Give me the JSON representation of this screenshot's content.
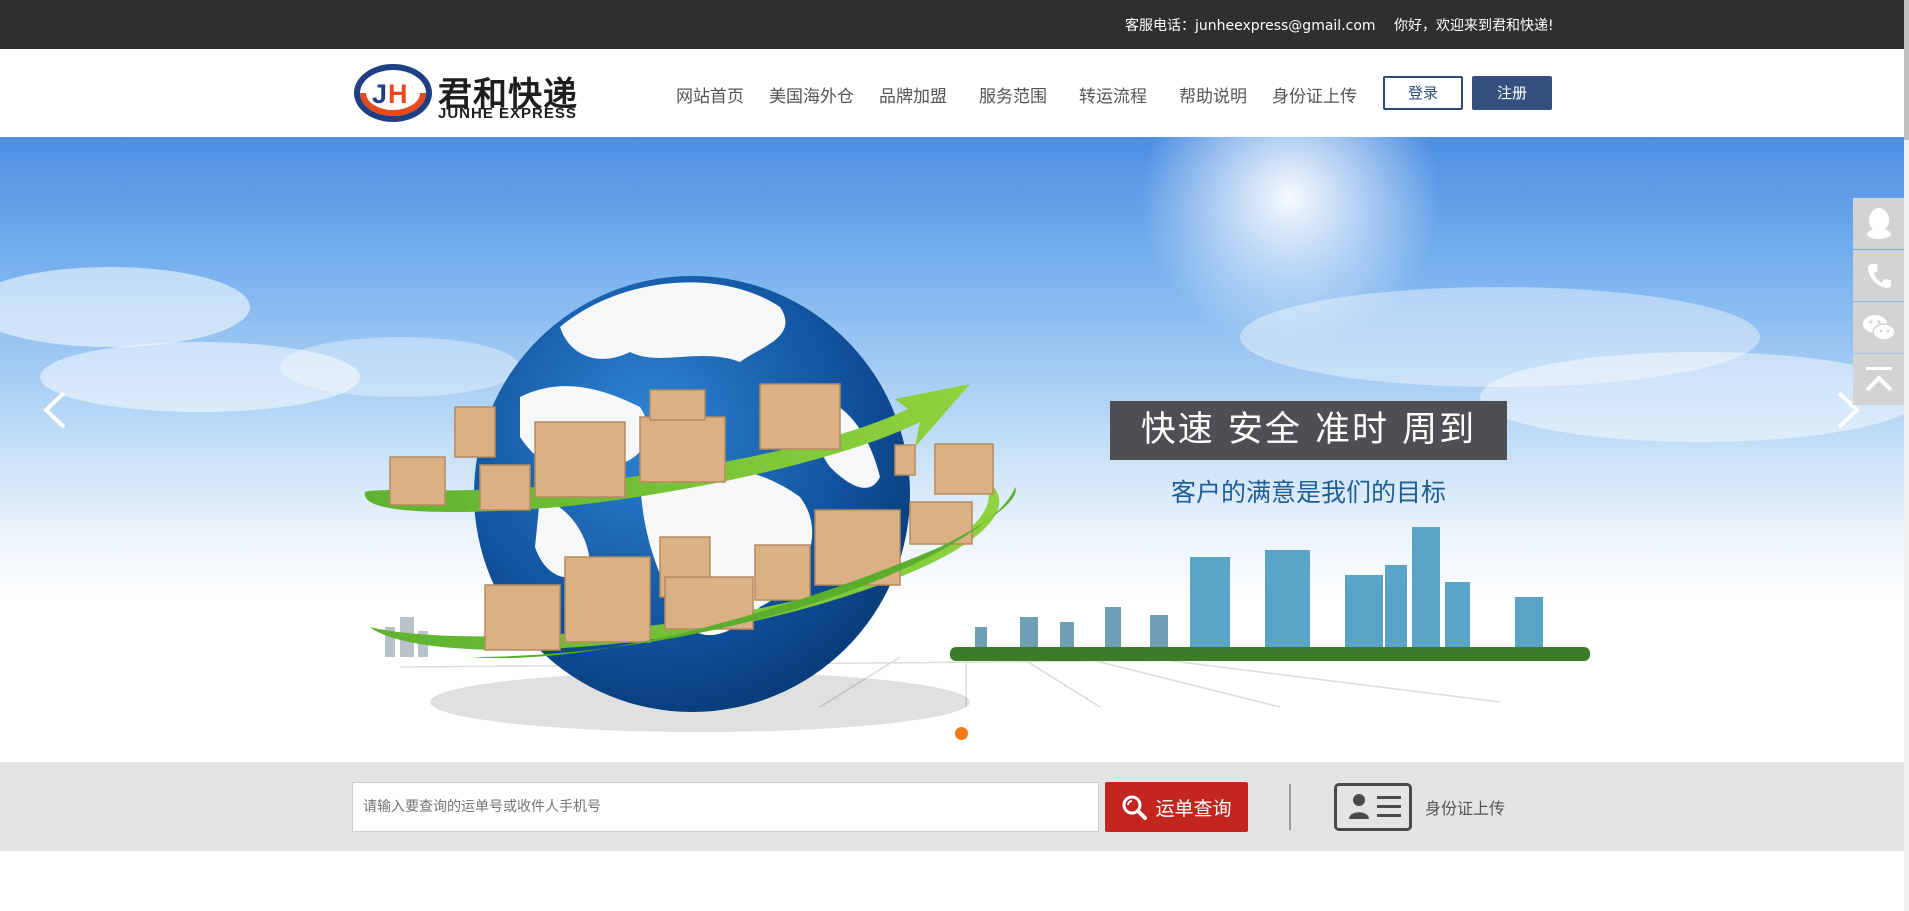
{
  "topbar": {
    "hotline": "客服电话：junheexpress@gmail.com",
    "welcome": "你好，欢迎来到君和快递!"
  },
  "logo": {
    "mark_text": "JH",
    "name_cn": "君和快递",
    "name_en": "JUNHE EXPRESS"
  },
  "nav": {
    "items": [
      "网站首页",
      "美国海外仓",
      "品牌加盟",
      "服务范围",
      "转运流程",
      "帮助说明",
      "身份证上传"
    ],
    "login": "登录",
    "register": "注册"
  },
  "banner": {
    "slogan": "快速 安全 准时 周到",
    "subtitle": "客户的满意是我们的目标"
  },
  "search": {
    "placeholder": "请输入要查询的运单号或收件人手机号",
    "button": "运单查询",
    "id_upload": "身份证上传"
  },
  "sidebar": {
    "icons": [
      "qq-icon",
      "phone-icon",
      "wechat-icon",
      "back-to-top-icon"
    ]
  },
  "colors": {
    "topbar": "#2f2f2f",
    "brand_blue": "#35507e",
    "search_red": "#c3251f",
    "dot_orange": "#f07a1c"
  }
}
